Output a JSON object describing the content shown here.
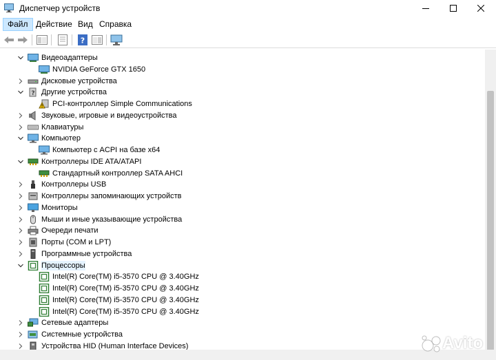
{
  "window": {
    "title": "Диспетчер устройств"
  },
  "menu": [
    {
      "label": "Файл"
    },
    {
      "label": "Действие"
    },
    {
      "label": "Вид"
    },
    {
      "label": "Справка"
    }
  ],
  "tree": [
    {
      "label": "Видеоадаптеры",
      "icon": "display-adapter-icon",
      "expanded": true,
      "level": 0
    },
    {
      "label": "NVIDIA GeForce GTX 1650",
      "icon": "display-adapter-icon",
      "level": 1
    },
    {
      "label": "Дисковые устройства",
      "icon": "disk-drive-icon",
      "expanded": false,
      "level": 0
    },
    {
      "label": "Другие устройства",
      "icon": "unknown-device-icon",
      "expanded": true,
      "level": 0
    },
    {
      "label": "PCI-контроллер Simple Communications",
      "icon": "warning-device-icon",
      "level": 1
    },
    {
      "label": "Звуковые, игровые и видеоустройства",
      "icon": "speaker-icon",
      "expanded": false,
      "level": 0
    },
    {
      "label": "Клавиатуры",
      "icon": "keyboard-icon",
      "expanded": false,
      "level": 0
    },
    {
      "label": "Компьютер",
      "icon": "computer-icon",
      "expanded": true,
      "level": 0
    },
    {
      "label": "Компьютер с ACPI на базе x64",
      "icon": "computer-icon",
      "level": 1
    },
    {
      "label": "Контроллеры IDE ATA/ATAPI",
      "icon": "ide-controller-icon",
      "expanded": true,
      "level": 0
    },
    {
      "label": "Стандартный контроллер SATA AHCI",
      "icon": "ide-controller-icon",
      "level": 1
    },
    {
      "label": "Контроллеры USB",
      "icon": "usb-icon",
      "expanded": false,
      "level": 0
    },
    {
      "label": "Контроллеры запоминающих устройств",
      "icon": "storage-controller-icon",
      "expanded": false,
      "level": 0
    },
    {
      "label": "Мониторы",
      "icon": "monitor-icon",
      "expanded": false,
      "level": 0
    },
    {
      "label": "Мыши и иные указывающие устройства",
      "icon": "mouse-icon",
      "expanded": false,
      "level": 0
    },
    {
      "label": "Очереди печати",
      "icon": "printer-icon",
      "expanded": false,
      "level": 0
    },
    {
      "label": "Порты (COM и LPT)",
      "icon": "port-icon",
      "expanded": false,
      "level": 0
    },
    {
      "label": "Программные устройства",
      "icon": "software-device-icon",
      "expanded": false,
      "level": 0
    },
    {
      "label": "Процессоры",
      "icon": "processor-icon",
      "expanded": true,
      "level": 0,
      "selected": true
    },
    {
      "label": "Intel(R) Core(TM) i5-3570 CPU @ 3.40GHz",
      "icon": "processor-icon",
      "level": 1
    },
    {
      "label": "Intel(R) Core(TM) i5-3570 CPU @ 3.40GHz",
      "icon": "processor-icon",
      "level": 1
    },
    {
      "label": "Intel(R) Core(TM) i5-3570 CPU @ 3.40GHz",
      "icon": "processor-icon",
      "level": 1
    },
    {
      "label": "Intel(R) Core(TM) i5-3570 CPU @ 3.40GHz",
      "icon": "processor-icon",
      "level": 1
    },
    {
      "label": "Сетевые адаптеры",
      "icon": "network-adapter-icon",
      "expanded": false,
      "level": 0
    },
    {
      "label": "Системные устройства",
      "icon": "system-device-icon",
      "expanded": false,
      "level": 0
    },
    {
      "label": "Устройства HID (Human Interface Devices)",
      "icon": "hid-icon",
      "expanded": false,
      "level": 0
    }
  ],
  "watermark": {
    "text": "Avito"
  },
  "colors": {
    "selection": "#e5f3ff",
    "menu_active": "#cce8ff",
    "processor_green": "#2e7d32"
  }
}
